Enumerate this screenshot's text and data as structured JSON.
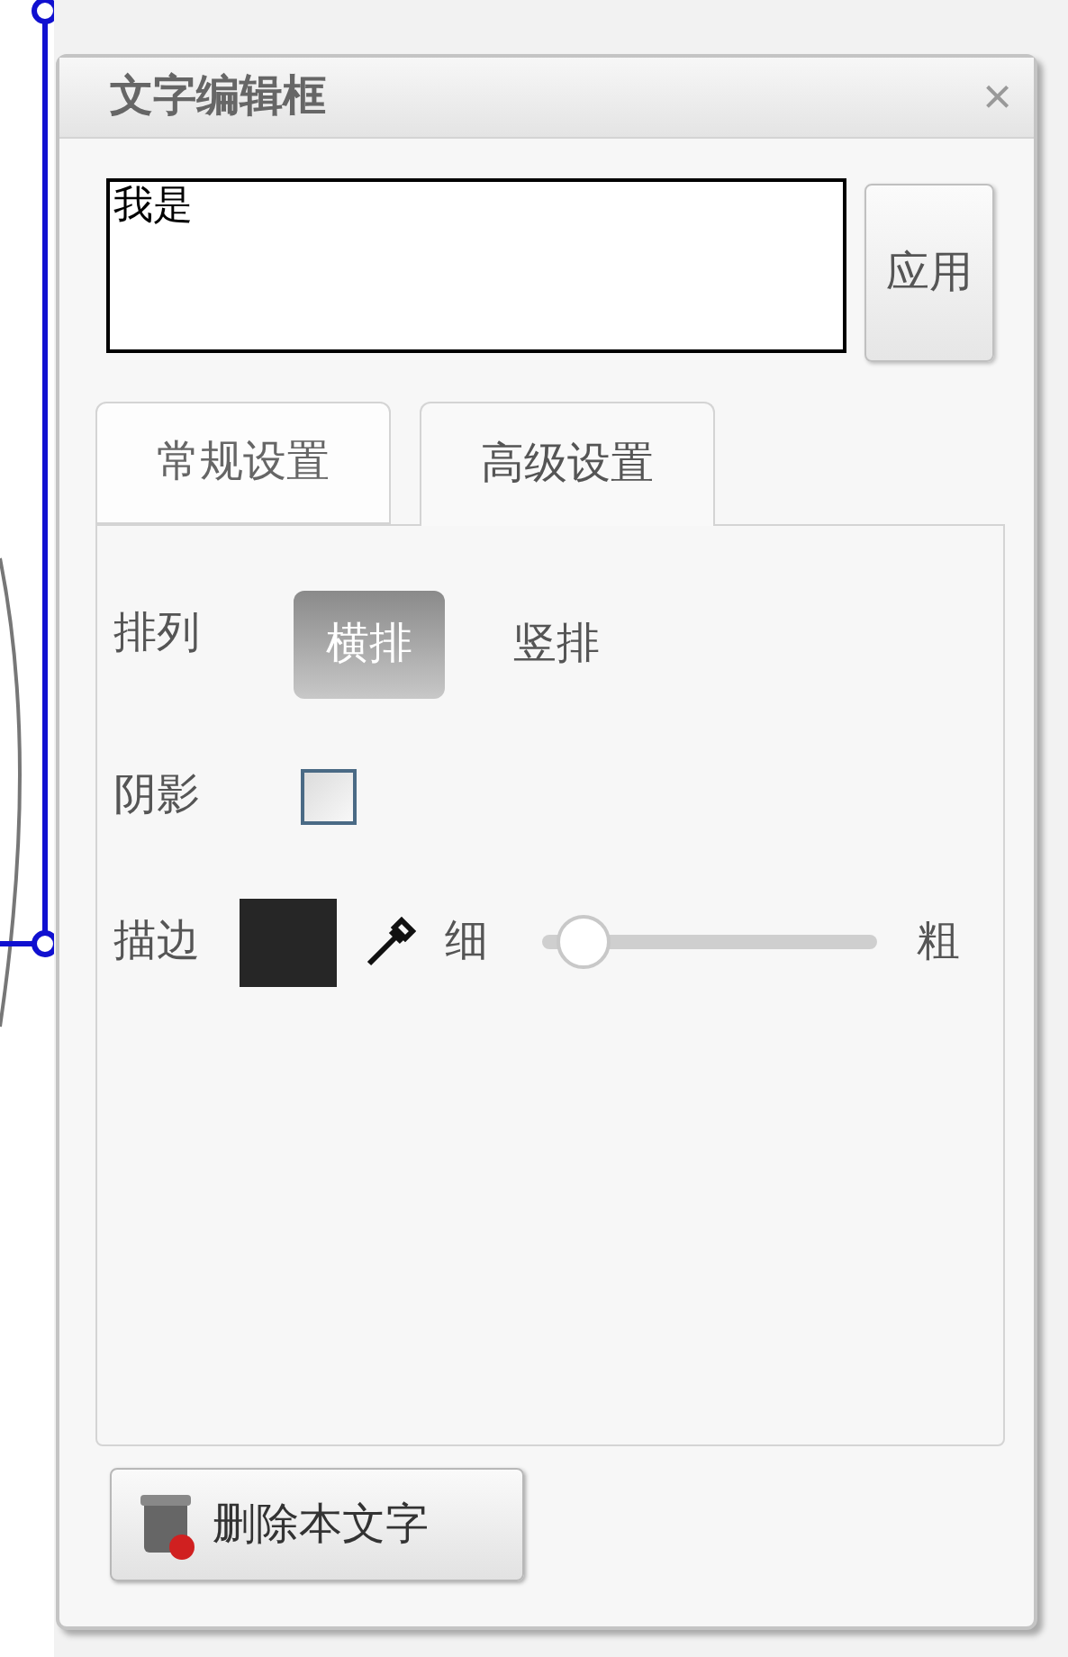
{
  "panel": {
    "title": "文字编辑框",
    "close": "×",
    "text_value": "我是",
    "apply_button": "应用",
    "tabs": [
      {
        "label": "常规设置",
        "selected": false
      },
      {
        "label": "高级设置",
        "selected": true
      }
    ],
    "arrangement": {
      "label": "排列",
      "options": [
        {
          "label": "横排",
          "selected": true
        },
        {
          "label": "竖排",
          "selected": false
        }
      ]
    },
    "shadow": {
      "label": "阴影",
      "checked": false
    },
    "stroke": {
      "label": "描边",
      "color": "#262626",
      "thin_label": "细",
      "thick_label": "粗",
      "level": 0.05
    },
    "delete_button": "删除本文字"
  }
}
